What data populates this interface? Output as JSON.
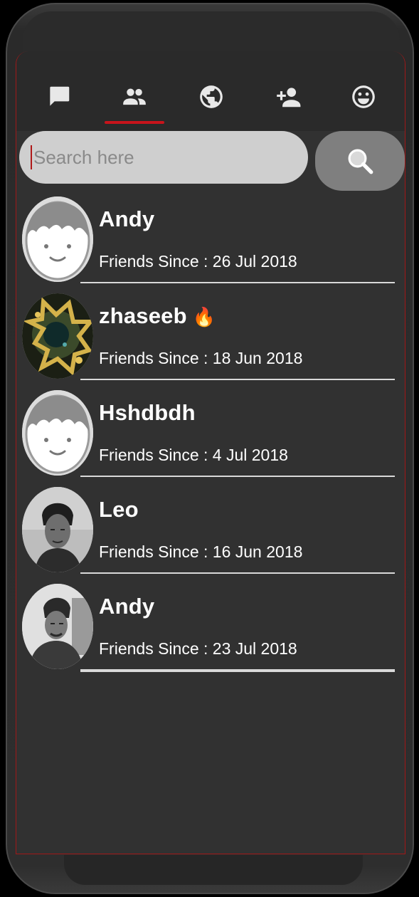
{
  "tabs": [
    {
      "name": "chat-icon"
    },
    {
      "name": "friends-icon"
    },
    {
      "name": "globe-icon"
    },
    {
      "name": "add-friend-icon"
    },
    {
      "name": "smiley-icon"
    }
  ],
  "active_tab_index": 1,
  "search": {
    "placeholder": "Search here",
    "button_icon": "search-icon"
  },
  "friends": [
    {
      "name": "Andy",
      "emoji": "",
      "since": "Friends Since : 26 Jul 2018",
      "avatar": "default-avatar"
    },
    {
      "name": "zhaseeb",
      "emoji": "🔥",
      "since": "Friends Since : 18 Jun 2018",
      "avatar": "photo-avatar"
    },
    {
      "name": "Hshdbdh",
      "emoji": "",
      "since": "Friends Since : 4 Jul 2018",
      "avatar": "default-avatar"
    },
    {
      "name": "Leo",
      "emoji": "",
      "since": "Friends Since : 16 Jun 2018",
      "avatar": "photo-avatar"
    },
    {
      "name": "Andy",
      "emoji": "",
      "since": "Friends Since : 23 Jul 2018",
      "avatar": "photo-avatar"
    }
  ],
  "colors": {
    "accent": "#c8141b",
    "background": "#313131",
    "tabbar": "#2a2a2a",
    "search_field": "#cfcfcf",
    "search_button": "#7f7f7f"
  }
}
